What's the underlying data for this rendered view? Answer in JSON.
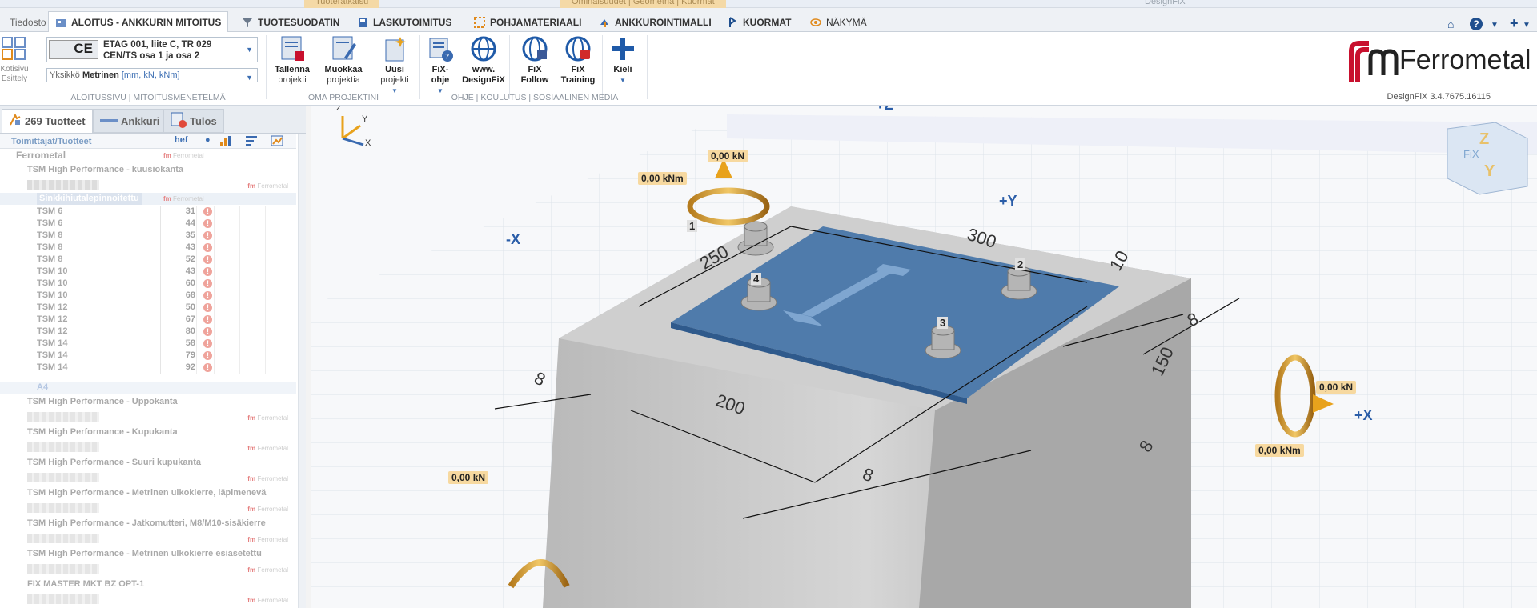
{
  "titlebar": {
    "ctx1": "Tuoteratkaisu",
    "ctx2": "Ominaisuudet | Geometria | Kuormat",
    "app": "DesignFiX"
  },
  "tabs": {
    "file": "Tiedosto",
    "items": [
      {
        "label": "ALOITUS - ANKKURIN MITOITUS",
        "icon": "home-icon"
      },
      {
        "label": "TUOTESUODATIN",
        "icon": "filter-icon"
      },
      {
        "label": "LASKUTOIMITUS",
        "icon": "calculator-icon"
      },
      {
        "label": "POHJAMATERIAALI",
        "icon": "material-icon"
      },
      {
        "label": "ANKKUROINTIMALLI",
        "icon": "model-icon"
      },
      {
        "label": "KUORMAT",
        "icon": "load-icon"
      },
      {
        "label": "NÄKYMÄ",
        "icon": "eye-icon"
      }
    ]
  },
  "ribbon": {
    "home_label": "Kotisivu\nEsittely",
    "etag_line1": "ETAG 001, liite C, TR 029",
    "etag_line2": "CEN/TS osa 1 ja osa 2",
    "ce": "CE",
    "units_prefix": "Yksikkö",
    "units_value": "Metrinen",
    "units_detail": "[mm, kN, kNm]",
    "group1": "ALOITUSSIVU | MITOITUSMENETELMÄ",
    "group2": "OMA PROJEKTINI",
    "group3": "OHJE | KOULUTUS | SOSIAALINEN MEDIA",
    "buttons": [
      {
        "b": "Tallenna",
        "s": "projekti"
      },
      {
        "b": "Muokkaa",
        "s": "projektia"
      },
      {
        "b": "Uusi",
        "s": "projekti"
      },
      {
        "b": "FiX-",
        "s": "ohje"
      },
      {
        "b": "www.",
        "s": "DesignFiX"
      },
      {
        "b": "FiX",
        "s": "Follow"
      },
      {
        "b": "FiX",
        "s": "Training"
      },
      {
        "b": "Kieli",
        "s": ""
      }
    ],
    "version": "DesignFiX 3.4.7675.16115",
    "brand": "Ferrometal",
    "brand_color": "#c8102e"
  },
  "panel": {
    "tabs": [
      "269 Tuotteet",
      "Ankkuri",
      "Tulos"
    ],
    "header_col1": "Toimittajat/Tuotteet",
    "header_col2": "hef",
    "supplier": "Ferrometal",
    "brand_mini": "Ferrometal",
    "group1": "TSM High Performance - kuusiokanta",
    "subgroup": "Sinkkihiutalepinnoitettu",
    "rows": [
      {
        "name": "TSM 6",
        "val": "31"
      },
      {
        "name": "TSM 6",
        "val": "44"
      },
      {
        "name": "TSM 8",
        "val": "35"
      },
      {
        "name": "TSM 8",
        "val": "43"
      },
      {
        "name": "TSM 8",
        "val": "52"
      },
      {
        "name": "TSM 10",
        "val": "43"
      },
      {
        "name": "TSM 10",
        "val": "60"
      },
      {
        "name": "TSM 10",
        "val": "68"
      },
      {
        "name": "TSM 12",
        "val": "50"
      },
      {
        "name": "TSM 12",
        "val": "67"
      },
      {
        "name": "TSM 12",
        "val": "80"
      },
      {
        "name": "TSM 14",
        "val": "58"
      },
      {
        "name": "TSM 14",
        "val": "79"
      },
      {
        "name": "TSM 14",
        "val": "92"
      }
    ],
    "a4": "A4",
    "groups": [
      "TSM High Performance - Uppokanta",
      "TSM High Performance - Kupukanta",
      "TSM High Performance - Suuri kupukanta",
      "TSM High Performance - Metrinen ulkokierre, läpimenevä",
      "TSM High Performance - Jatkomutteri, M8/M10-sisäkierre",
      "TSM High Performance - Metrinen ulkokierre esiasetettu",
      "FIX MASTER MKT BZ OPT-1"
    ]
  },
  "view": {
    "axes": {
      "pz": "+Z",
      "py": "+Y",
      "mx": "-X",
      "px": "+X"
    },
    "triad": {
      "z": "Z",
      "y": "Y",
      "x": "X"
    },
    "cube": {
      "z": "Z",
      "fix": "FiX",
      "y": "Y"
    },
    "loads": {
      "n_top": "0,00 kN",
      "m_top": "0,00 kNm",
      "n_right": "0,00 kN",
      "m_right": "0,00 kNm",
      "n_left": "0,00 kN"
    },
    "anchors": [
      "1",
      "2",
      "3",
      "4"
    ],
    "dims": [
      "250",
      "300",
      "10",
      "8",
      "150",
      "8",
      "200",
      "8",
      "8"
    ]
  }
}
